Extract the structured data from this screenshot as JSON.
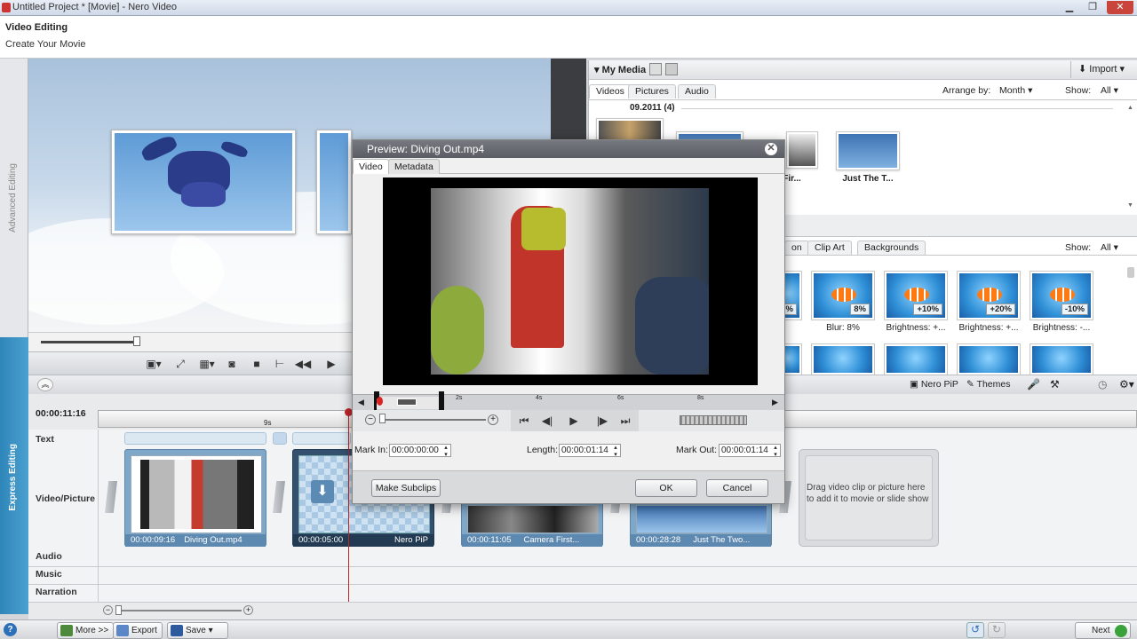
{
  "window": {
    "title": "Untitled Project * [Movie] - Nero Video",
    "min": "▁",
    "max": "❐",
    "close": "✕"
  },
  "header": {
    "title": "Video Editing",
    "subtitle": "Create Your Movie"
  },
  "left_tabs": {
    "advanced": "Advanced Editing",
    "express": "Express Editing"
  },
  "media": {
    "title": "My Media",
    "import": "Import",
    "tabs": [
      "Videos",
      "Pictures",
      "Audio"
    ],
    "arrange_label": "Arrange by:",
    "arrange_value": "Month",
    "show_label": "Show:",
    "show_value": "All",
    "group": "09.2011 (4)",
    "items": [
      {
        "caption": ""
      },
      {
        "caption": ""
      },
      {
        "caption": "ra Fir..."
      },
      {
        "caption": "Just The T..."
      }
    ]
  },
  "effects": {
    "tabs": [
      "on",
      "Clip Art",
      "Backgrounds"
    ],
    "show_label": "Show:",
    "show_value": "All",
    "items": [
      {
        "badge": "%",
        "caption": ""
      },
      {
        "badge": "8%",
        "caption": "Blur: 8%"
      },
      {
        "badge": "+10%",
        "caption": "Brightness: +..."
      },
      {
        "badge": "+20%",
        "caption": "Brightness: +..."
      },
      {
        "badge": "-10%",
        "caption": "Brightness: -..."
      }
    ]
  },
  "toolbar": {
    "nero_pip": "Nero PiP",
    "themes": "Themes"
  },
  "timeline": {
    "current_time": "00:00:11:16",
    "ruler_mark": "9s",
    "tracks": {
      "text": "Text",
      "video": "Video/Picture",
      "audio": "Audio",
      "music": "Music",
      "narration": "Narration"
    },
    "clips": [
      {
        "time": "00:00:09:16",
        "name": "Diving Out.mp4"
      },
      {
        "time": "00:00:05:00",
        "name": "Nero PiP"
      },
      {
        "time": "00:00:11:05",
        "name": "Camera First..."
      },
      {
        "time": "00:00:28:28",
        "name": "Just The Two..."
      }
    ],
    "drop_hint": "Drag video clip or picture here to add it to movie or slide show"
  },
  "dialog": {
    "title": "Preview: Diving Out.mp4",
    "tabs": [
      "Video",
      "Metadata"
    ],
    "ticks": [
      "2s",
      "4s",
      "6s",
      "8s"
    ],
    "mark_in_label": "Mark In:",
    "mark_in": "00:00:00:00",
    "length_label": "Length:",
    "length": "00:00:01:14",
    "mark_out_label": "Mark Out:",
    "mark_out": "00:00:01:14",
    "make_subclips": "Make Subclips",
    "ok": "OK",
    "cancel": "Cancel"
  },
  "bottom": {
    "more": "More >>",
    "export": "Export",
    "save": "Save",
    "next": "Next"
  }
}
